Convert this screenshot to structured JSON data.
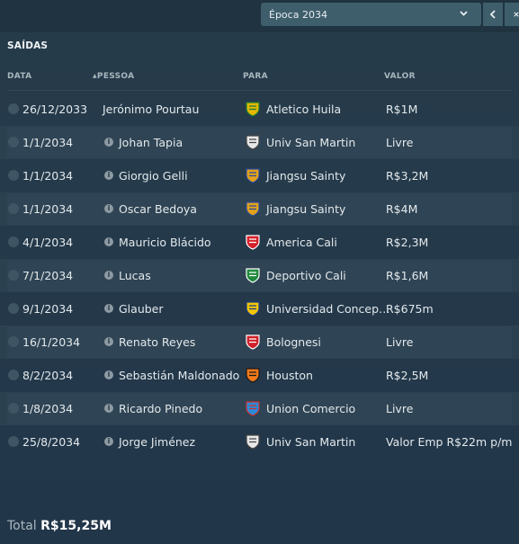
{
  "season": {
    "label": "Época 2034",
    "chevron_icon": "chevron-down-icon",
    "prev_icon": "chevron-left-icon",
    "next_icon": "close-icon"
  },
  "section": {
    "title": "SAÍDAS"
  },
  "columns": {
    "date": "DATA",
    "person": "PESSOA",
    "to": "PARA",
    "value": "VALOR",
    "sort_glyph": "▲"
  },
  "rows": [
    {
      "date": "26/12/2033",
      "person": "Jerónimo Pourtau",
      "club": "Atletico Huila",
      "value": "R$1M",
      "has_info": false,
      "badge_color": "#e4b800",
      "badge_color2": "#1a7a3a",
      "badge_icon": "atletico-huila-badge-icon"
    },
    {
      "date": "1/1/2034",
      "person": "Johan Tapia",
      "club": "Univ San Martin",
      "value": "Livre",
      "has_info": true,
      "badge_color": "#e8e8e8",
      "badge_color2": "#444444",
      "badge_icon": "univ-san-martin-badge-icon"
    },
    {
      "date": "1/1/2034",
      "person": "Giorgio Gelli",
      "club": "Jiangsu Sainty",
      "value": "R$3,2M",
      "has_info": true,
      "badge_color": "#e3a21a",
      "badge_color2": "#2a4aa0",
      "badge_icon": "jiangsu-sainty-badge-icon"
    },
    {
      "date": "1/1/2034",
      "person": "Oscar Bedoya",
      "club": "Jiangsu Sainty",
      "value": "R$4M",
      "has_info": true,
      "badge_color": "#e3a21a",
      "badge_color2": "#2a4aa0",
      "badge_icon": "jiangsu-sainty-badge-icon"
    },
    {
      "date": "4/1/2034",
      "person": "Mauricio Blácido",
      "club": "America Cali",
      "value": "R$2,3M",
      "has_info": true,
      "badge_color": "#d6202a",
      "badge_color2": "#ffffff",
      "badge_icon": "america-cali-badge-icon"
    },
    {
      "date": "7/1/2034",
      "person": "Lucas",
      "club": "Deportivo Cali",
      "value": "R$1,6M",
      "has_info": true,
      "badge_color": "#1f8a3c",
      "badge_color2": "#ffffff",
      "badge_icon": "deportivo-cali-badge-icon"
    },
    {
      "date": "9/1/2034",
      "person": "Glauber",
      "club": "Universidad Concep…",
      "value": "R$675m",
      "has_info": true,
      "badge_color": "#f2c500",
      "badge_color2": "#1a3c8c",
      "badge_icon": "universidad-concepcion-badge-icon"
    },
    {
      "date": "16/1/2034",
      "person": "Renato Reyes",
      "club": "Bolognesi",
      "value": "Livre",
      "has_info": true,
      "badge_color": "#d0202a",
      "badge_color2": "#ffffff",
      "badge_icon": "bolognesi-badge-icon"
    },
    {
      "date": "8/2/2034",
      "person": "Sebastián Maldonado",
      "club": "Houston",
      "value": "R$2,5M",
      "has_info": true,
      "badge_color": "#f07a1a",
      "badge_color2": "#1a1a1a",
      "badge_icon": "houston-badge-icon"
    },
    {
      "date": "1/8/2034",
      "person": "Ricardo Pinedo",
      "club": "Union Comercio",
      "value": "Livre",
      "has_info": true,
      "badge_color": "#2a8ad8",
      "badge_color2": "#d03030",
      "badge_icon": "union-comercio-badge-icon"
    },
    {
      "date": "25/8/2034",
      "person": "Jorge Jiménez",
      "club": "Univ San Martin",
      "value": "Valor Emp R$22m p/m",
      "has_info": true,
      "badge_color": "#e8e8e8",
      "badge_color2": "#444444",
      "badge_icon": "univ-san-martin-badge-icon"
    }
  ],
  "footer": {
    "total_label": "Total",
    "total_value": "R$15,25M"
  }
}
